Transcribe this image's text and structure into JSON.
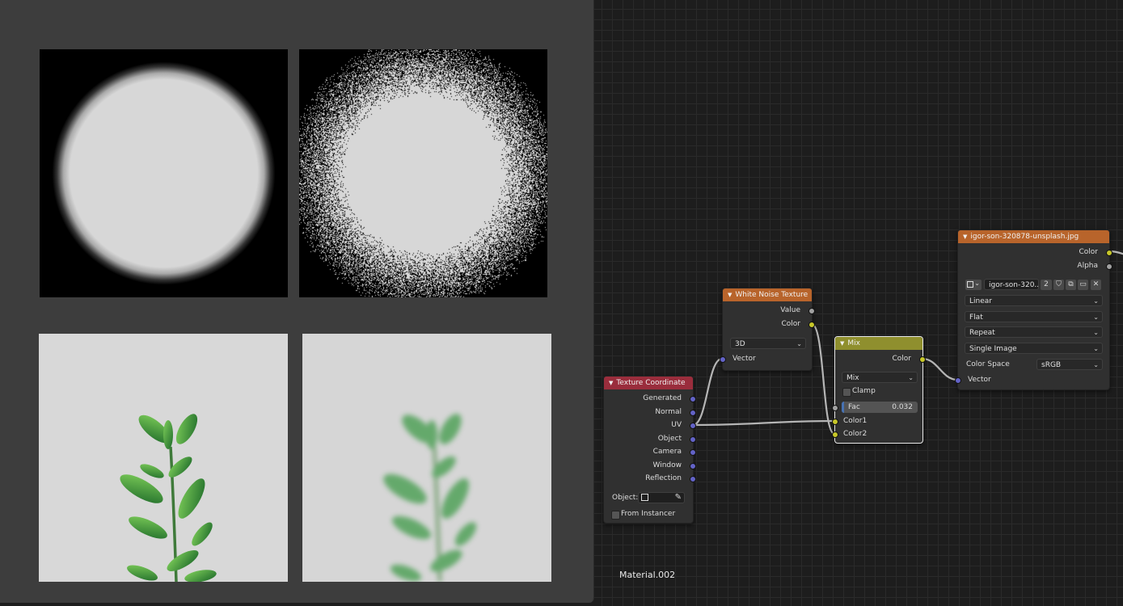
{
  "material_name": "Material.002",
  "nodes": {
    "texture_coordinate": {
      "title": "Texture Coordinate",
      "outputs": [
        "Generated",
        "Normal",
        "UV",
        "Object",
        "Camera",
        "Window",
        "Reflection"
      ],
      "object_label": "Object:",
      "from_instancer": "From Instancer"
    },
    "white_noise": {
      "title": "White Noise Texture",
      "outputs": [
        "Value",
        "Color"
      ],
      "dimensions": "3D",
      "input": "Vector"
    },
    "mix": {
      "title": "Mix",
      "output": "Color",
      "blend_mode": "Mix",
      "clamp": "Clamp",
      "fac_label": "Fac",
      "fac_value": "0.032",
      "inputs": [
        "Color1",
        "Color2"
      ]
    },
    "image_texture": {
      "title": "igor-son-320878-unsplash.jpg",
      "outputs": [
        "Color",
        "Alpha"
      ],
      "image_name": "igor-son-320...",
      "users": "2",
      "interpolation": "Linear",
      "projection": "Flat",
      "extension": "Repeat",
      "source": "Single Image",
      "color_space_label": "Color Space",
      "color_space": "sRGB",
      "input": "Vector"
    }
  },
  "colors": {
    "input_header": "#9a2d3c",
    "texture_header": "#b8642b",
    "color_header": "#8f8f2e",
    "vector_socket": "#6363c7",
    "color_socket": "#c7c729",
    "value_socket": "#a1a1a1"
  }
}
